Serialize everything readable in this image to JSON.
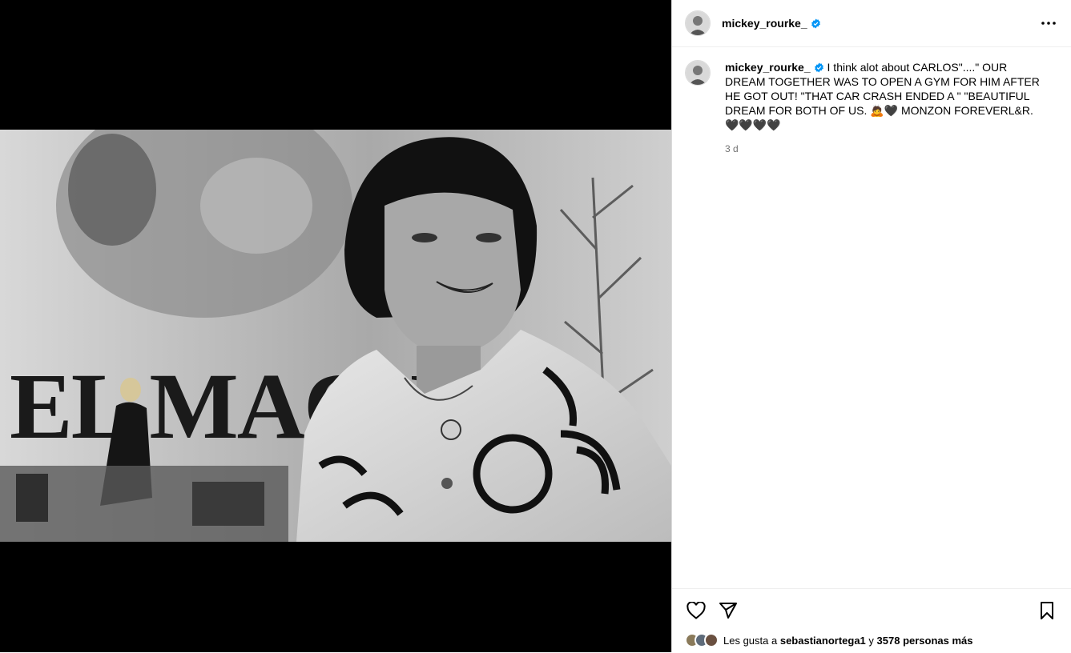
{
  "post": {
    "username": "mickey_rourke_",
    "caption": "I think alot about CARLOS\"....\" OUR DREAM TOGETHER WAS TO OPEN A GYM FOR HIM AFTER HE GOT OUT! \"THAT CAR CRASH ENDED A \" \"BEAUTIFUL DREAM FOR BOTH OF US. 🙇🖤 MONZON FOREVERL&R. 🖤🖤🖤🖤",
    "time": "3 d",
    "likes_prefix": "Les gusta a",
    "likes_user": "sebastianortega1",
    "likes_joiner": "y",
    "likes_count": "3578 personas más"
  },
  "photo": {
    "poster_text": "EL MACHO"
  },
  "icons": {
    "verified": "verified-badge-icon",
    "more": "more-options-icon",
    "like": "heart-icon",
    "share": "paper-plane-icon",
    "save": "bookmark-icon"
  },
  "colors": {
    "verified": "#0095f6",
    "muted": "#737373"
  }
}
